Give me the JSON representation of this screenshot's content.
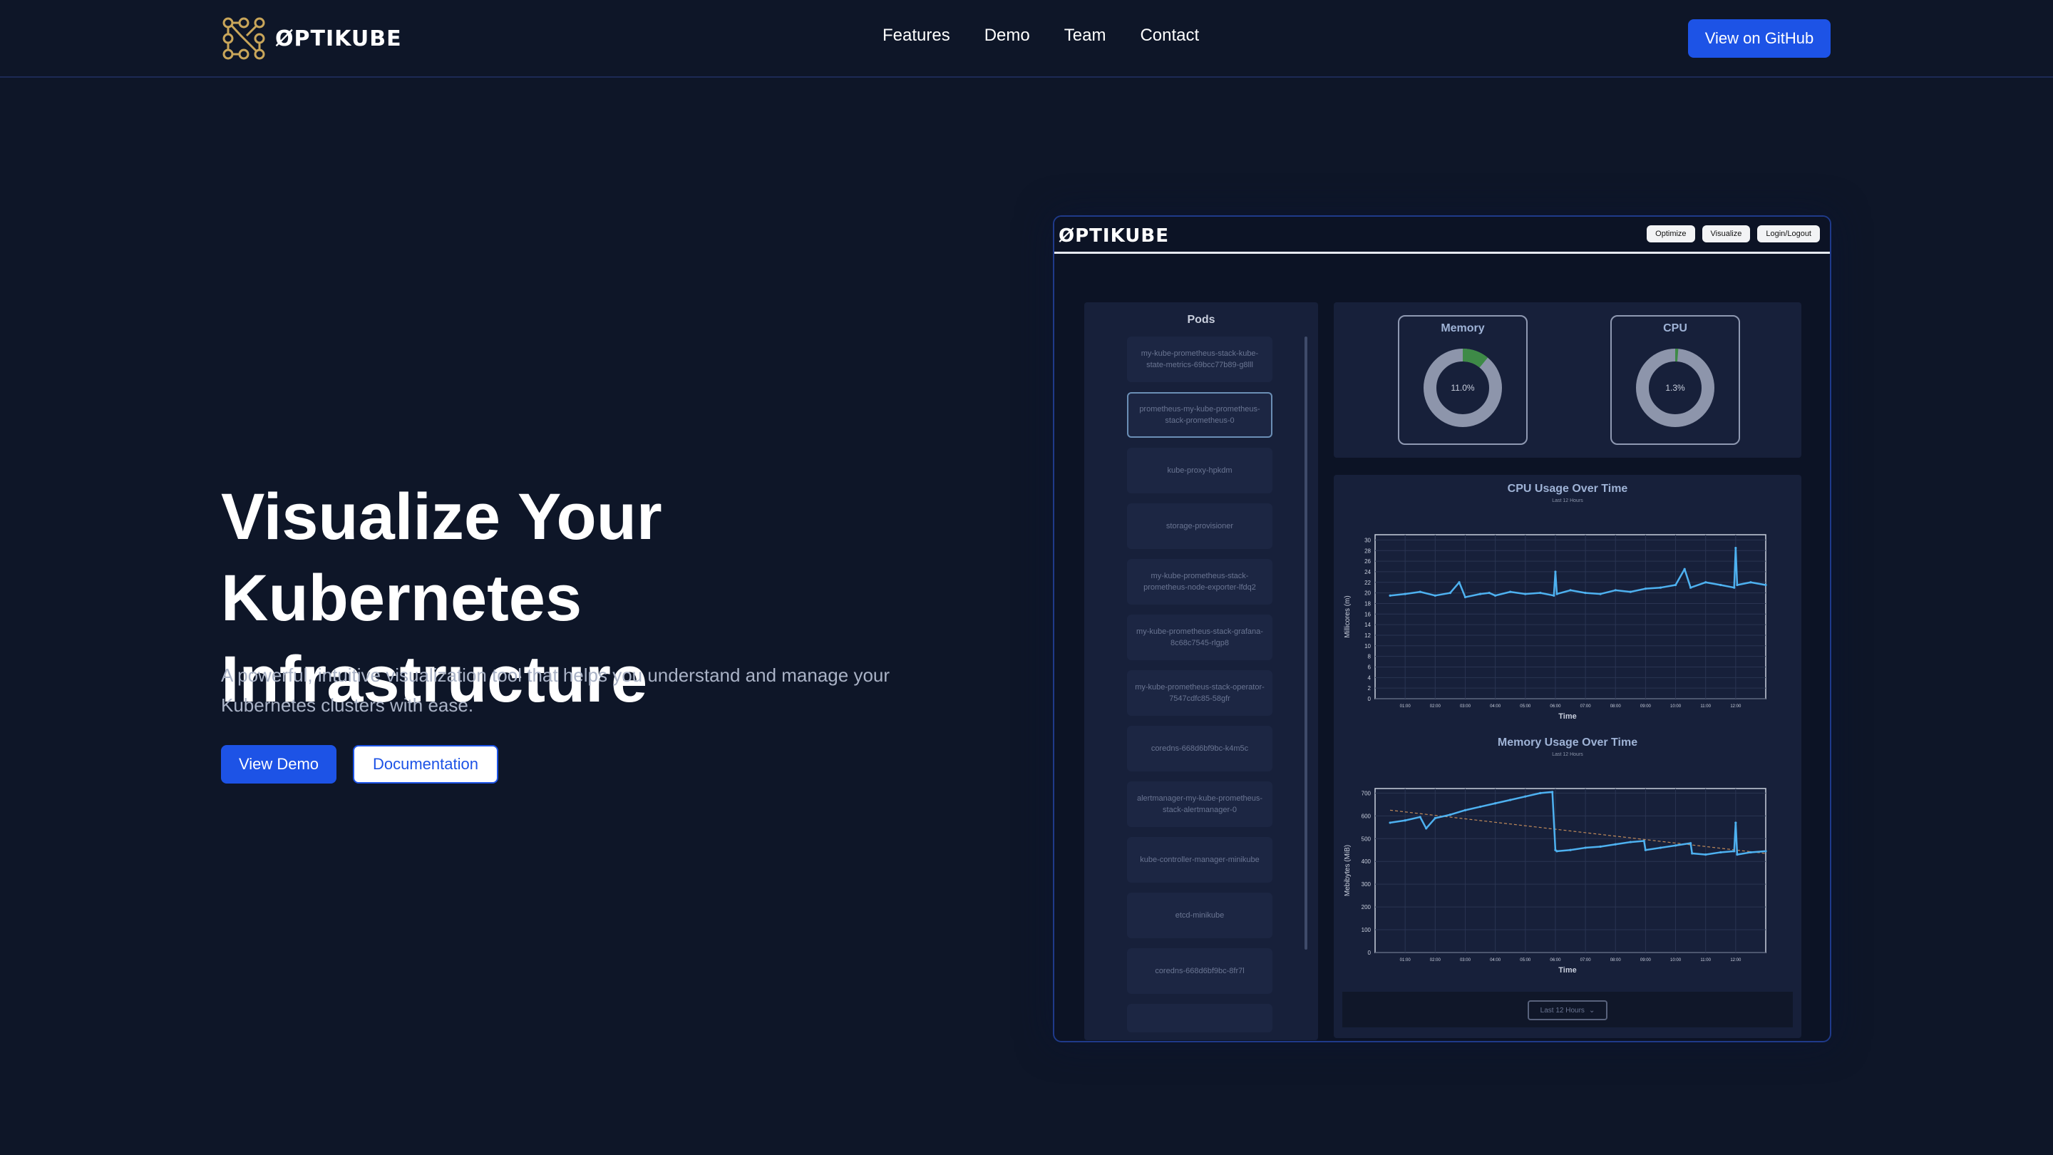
{
  "nav": {
    "brand": "ØPTIKUBE",
    "links": [
      "Features",
      "Demo",
      "Team",
      "Contact"
    ],
    "github_label": "View on GitHub"
  },
  "hero": {
    "title_line1": "Visualize Your Kubernetes",
    "title_line2": "Infrastructure",
    "subtitle_line1": "A powerful, intuitive visualization tool that helps you understand and manage your",
    "subtitle_line2": "Kubernetes clusters with ease.",
    "demo_label": "View Demo",
    "docs_label": "Documentation"
  },
  "colors": {
    "accent": "#1d53e6",
    "background": "#0e1628",
    "line": "#4eb1f0",
    "gauge_fill": "#3e8a47",
    "gauge_track": "#8d95ab"
  },
  "preview": {
    "brand": "ØPTIKUBE",
    "header_buttons": [
      "Optimize",
      "Visualize",
      "Login/Logout"
    ],
    "pods_title": "Pods",
    "pods": [
      "my-kube-prometheus-stack-kube-state-metrics-69bcc77b89-g8lll",
      "prometheus-my-kube-prometheus-stack-prometheus-0",
      "kube-proxy-hpkdm",
      "storage-provisioner",
      "my-kube-prometheus-stack-prometheus-node-exporter-lfdq2",
      "my-kube-prometheus-stack-grafana-8c68c7545-rlgp8",
      "my-kube-prometheus-stack-operator-7547cdfc85-58gfr",
      "coredns-668d6bf9bc-k4m5c",
      "alertmanager-my-kube-prometheus-stack-alertmanager-0",
      "kube-controller-manager-minikube",
      "etcd-minikube",
      "coredns-668d6bf9bc-8fr7l"
    ],
    "selected_pod_index": 1,
    "memory_gauge": {
      "label": "Memory",
      "value_text": "11.0%",
      "percent": 11.0
    },
    "cpu_gauge": {
      "label": "CPU",
      "value_text": "1.3%",
      "percent": 1.3
    },
    "time_range": "Last 12 Hours"
  },
  "chart_data": [
    {
      "type": "line",
      "title": "CPU Usage Over Time",
      "subtitle": "Last 12 Hours",
      "xlabel": "Time",
      "ylabel": "Millicores (m)",
      "x_ticks": [
        "01:00",
        "02:00",
        "03:00",
        "04:00",
        "05:00",
        "06:00",
        "07:00",
        "08:00",
        "09:00",
        "10:00",
        "11:00",
        "12:00"
      ],
      "y_ticks": [
        0,
        2,
        4,
        6,
        8,
        10,
        12,
        14,
        16,
        18,
        20,
        22,
        24,
        26,
        28,
        30
      ],
      "ylim": [
        0,
        31
      ],
      "x": [
        0.5,
        1,
        1.5,
        2,
        2.5,
        2.8,
        3,
        3.5,
        3.8,
        4,
        4.5,
        5,
        5.5,
        5.95,
        6,
        6.05,
        6.5,
        7,
        7.5,
        8,
        8.5,
        9,
        9.5,
        10,
        10.3,
        10.5,
        11,
        11.5,
        11.95,
        12,
        12.05,
        12.5,
        13
      ],
      "y": [
        19.5,
        19.8,
        20.2,
        19.5,
        20.0,
        22.0,
        19.2,
        19.8,
        20.0,
        19.5,
        20.2,
        19.8,
        20.0,
        19.5,
        24.0,
        19.8,
        20.5,
        20.0,
        19.8,
        20.5,
        20.2,
        20.8,
        21.0,
        21.5,
        24.5,
        21.0,
        22.0,
        21.5,
        21.0,
        28.5,
        21.5,
        22.0,
        21.5
      ],
      "grid": true
    },
    {
      "type": "line",
      "title": "Memory Usage Over Time",
      "subtitle": "Last 12 Hours",
      "xlabel": "Time",
      "ylabel": "Mebibytes (MiB)",
      "x_ticks": [
        "01:00",
        "02:00",
        "03:00",
        "04:00",
        "05:00",
        "06:00",
        "07:00",
        "08:00",
        "09:00",
        "10:00",
        "11:00",
        "12:00"
      ],
      "y_ticks": [
        0,
        100,
        200,
        300,
        400,
        500,
        600,
        700
      ],
      "ylim": [
        0,
        720
      ],
      "x": [
        0.5,
        1,
        1.5,
        1.7,
        2,
        2.5,
        3,
        3.5,
        4,
        4.5,
        5,
        5.5,
        5.9,
        6,
        6.05,
        6.5,
        7,
        7.5,
        8,
        8.5,
        8.95,
        9,
        9.5,
        10,
        10.5,
        10.55,
        11,
        11.5,
        11.95,
        12,
        12.05,
        12.5,
        13
      ],
      "y": [
        570,
        580,
        595,
        545,
        590,
        605,
        625,
        640,
        655,
        670,
        685,
        700,
        705,
        450,
        445,
        450,
        460,
        465,
        475,
        485,
        490,
        450,
        460,
        470,
        480,
        435,
        430,
        440,
        445,
        570,
        430,
        440,
        445
      ],
      "trend_x": [
        0.5,
        13
      ],
      "trend_y": [
        625,
        435
      ],
      "grid": true
    }
  ]
}
